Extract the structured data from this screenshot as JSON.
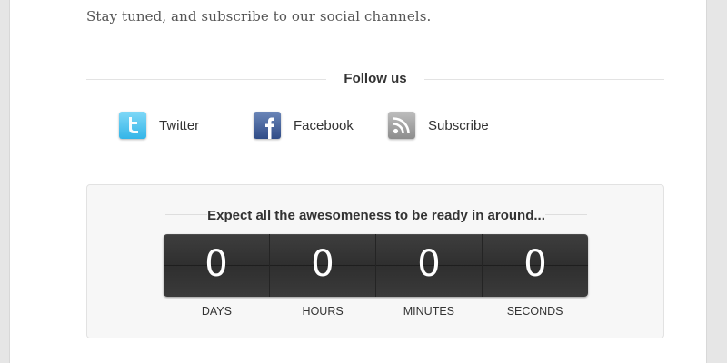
{
  "intro": {
    "tagline": "Stay tuned, and subscribe to our social channels."
  },
  "follow": {
    "title": "Follow us",
    "links": [
      {
        "label": "Twitter",
        "icon": "twitter-icon",
        "color": "#33b5e8"
      },
      {
        "label": "Facebook",
        "icon": "facebook-icon",
        "color": "#304c87"
      },
      {
        "label": "Subscribe",
        "icon": "rss-icon",
        "color": "#8d8d8d"
      }
    ]
  },
  "countdown": {
    "title": "Expect all the awesomeness to be ready in around...",
    "units": [
      {
        "value": "0",
        "label": "DAYS"
      },
      {
        "value": "0",
        "label": "HOURS"
      },
      {
        "value": "0",
        "label": "MINUTES"
      },
      {
        "value": "0",
        "label": "SECONDS"
      }
    ]
  }
}
